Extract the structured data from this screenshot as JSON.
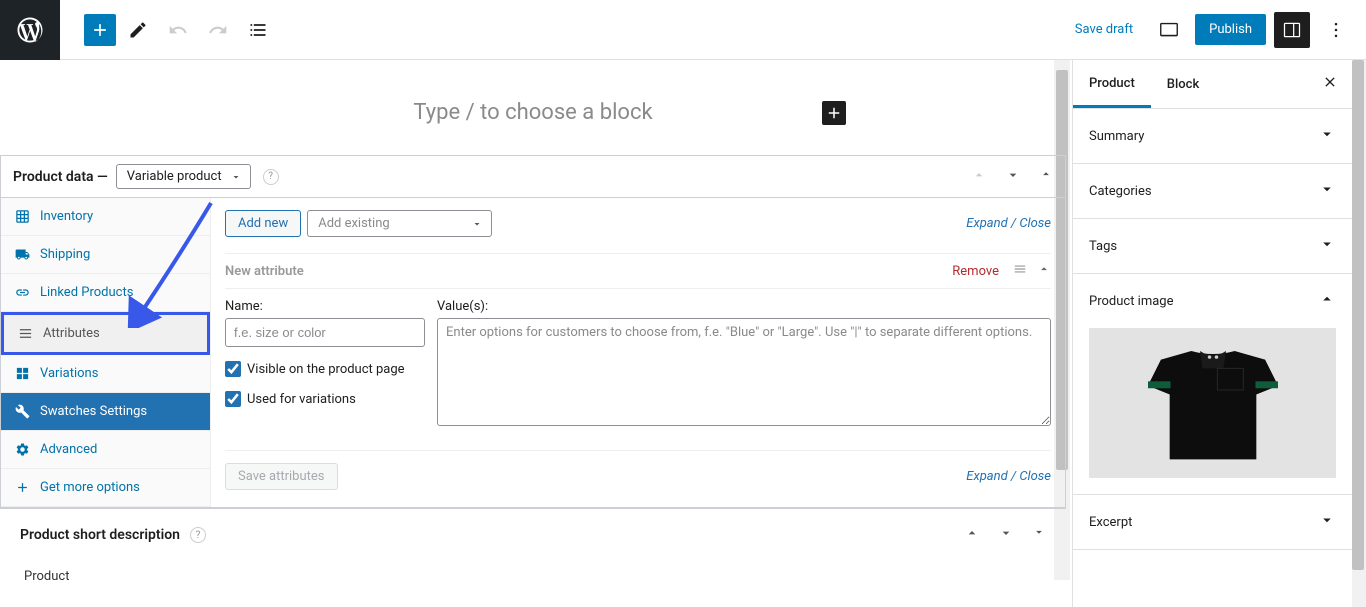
{
  "toolbar": {
    "save_draft": "Save draft",
    "publish": "Publish"
  },
  "editor": {
    "block_placeholder": "Type / to choose a block"
  },
  "product_data": {
    "label": "Product data —",
    "type_select": "Variable product",
    "tabs": {
      "inventory": "Inventory",
      "shipping": "Shipping",
      "linked_products": "Linked Products",
      "attributes": "Attributes",
      "variations": "Variations",
      "swatches_settings": "Swatches Settings",
      "advanced": "Advanced",
      "get_more_options": "Get more options"
    }
  },
  "attributes": {
    "add_new": "Add new",
    "add_existing": "Add existing",
    "expand_close": "Expand / Close",
    "new_attribute": "New attribute",
    "remove": "Remove",
    "name_label": "Name:",
    "name_placeholder": "f.e. size or color",
    "values_label": "Value(s):",
    "values_placeholder": "Enter options for customers to choose from, f.e. \"Blue\" or \"Large\". Use \"|\" to separate different options.",
    "visible_checkbox": "Visible on the product page",
    "used_for_variations": "Used for variations",
    "save_attributes": "Save attributes"
  },
  "short_desc": {
    "label": "Product short description"
  },
  "bottom_label": "Product",
  "sidebar": {
    "tabs": {
      "product": "Product",
      "block": "Block"
    },
    "panels": {
      "summary": "Summary",
      "categories": "Categories",
      "tags": "Tags",
      "product_image": "Product image",
      "excerpt": "Excerpt"
    }
  }
}
